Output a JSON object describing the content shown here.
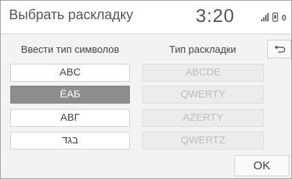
{
  "header": {
    "title": "Выбрать раскладку",
    "clock": "3:20",
    "status_icons": [
      "signal-icon",
      "phone-icon",
      "counter-icon"
    ],
    "counter_text": "0"
  },
  "columns": {
    "left_label": "Ввести тип символов",
    "right_label": "Тип раскладки"
  },
  "character_types": [
    {
      "label": "ABC",
      "selected": false
    },
    {
      "label": "ЁАБ",
      "selected": true
    },
    {
      "label": "ΑΒΓ",
      "selected": false
    },
    {
      "label": "בגד",
      "selected": false
    }
  ],
  "layout_types": [
    {
      "label": "ABCDE",
      "enabled": false
    },
    {
      "label": "QWERTY",
      "enabled": false
    },
    {
      "label": "AZERTY",
      "enabled": false
    },
    {
      "label": "QWERTZ",
      "enabled": false
    }
  ],
  "buttons": {
    "back_icon": "return-arrow-icon",
    "ok_label": "OK"
  },
  "colors": {
    "selected_bg": "#8d8d8d",
    "disabled_text": "#bdbdbd",
    "text": "#444444"
  }
}
